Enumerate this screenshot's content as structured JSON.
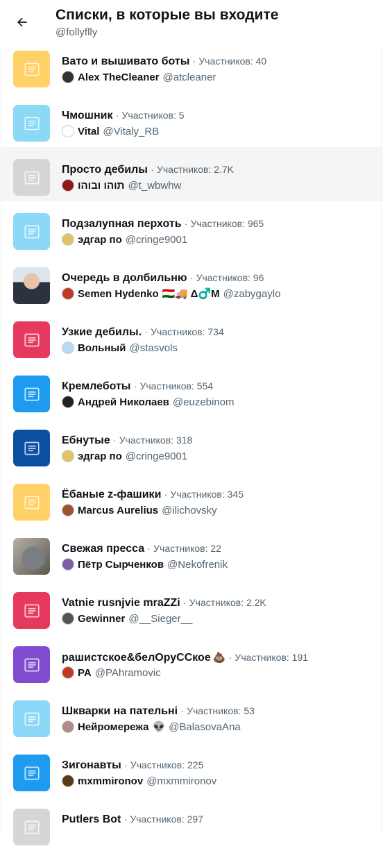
{
  "header": {
    "title": "Списки, в которые вы входите",
    "handle": "@follyflly"
  },
  "dot": "·",
  "lists": [
    {
      "name": "Вато и вышивато боты",
      "count": "Участников: 40",
      "owner": "Alex TheCleaner",
      "owner_handle": "@atcleaner",
      "thumb_color": "#ffd166",
      "avatar_color": "#333333"
    },
    {
      "name": "Чмошник",
      "count": "Участников: 5",
      "owner": "Vital",
      "owner_handle": "@Vitaly_RB",
      "thumb_color": "#8bd8f7",
      "avatar_color": "#ffffff"
    },
    {
      "name": "Просто дебилы",
      "count": "Участников: 2.7K",
      "owner": "תוהו ובוהו",
      "owner_handle": "@t_wbwhw",
      "thumb_color": "#d6d6d6",
      "avatar_color": "#8b1a1a"
    },
    {
      "name": "Подзалупная перхоть",
      "count": "Участников: 965",
      "owner": "эдгар по",
      "owner_handle": "@cringe9001",
      "thumb_color": "#8bd8f7",
      "avatar_color": "#e0c36a"
    },
    {
      "name": "Очередь в долбильню",
      "count": "Участников: 96",
      "owner": "Semen Hydenko",
      "owner_emoji": "🇹🇯🚚 Δ♂️M",
      "owner_handle": "@zabygaylo",
      "thumb_color": "#c9ced6",
      "avatar_color": "#c0392b",
      "thumb_photo": "person"
    },
    {
      "name": "Узкие дебилы.",
      "count": "Участников: 734",
      "owner": "Вольный",
      "owner_handle": "@stasvols",
      "thumb_color": "#e5395e",
      "avatar_color": "#b9d9f0"
    },
    {
      "name": "Кремлеботы",
      "count": "Участников: 554",
      "owner": "Андрей Николаев",
      "owner_handle": "@euzebinom",
      "thumb_color": "#1d9bf0",
      "avatar_color": "#222222"
    },
    {
      "name": "Ебнутые",
      "count": "Участников: 318",
      "owner": "эдгар по",
      "owner_handle": "@cringe9001",
      "thumb_color": "#0b4fa3",
      "avatar_color": "#e0c36a"
    },
    {
      "name": "Ёбаные z-фашики",
      "count": "Участников: 345",
      "owner": "Marcus Aurelius",
      "owner_handle": "@ilichovsky",
      "thumb_color": "#ffd166",
      "avatar_color": "#a0522d"
    },
    {
      "name": "Свежая пресса",
      "count": "Участников: 22",
      "owner": "Пётр Сырченков",
      "owner_handle": "@Nekofrenik",
      "thumb_color": "#8b8f95",
      "avatar_color": "#7b5ea7",
      "thumb_photo": "cat"
    },
    {
      "name": "Vatnie rusnjvie mraZZi",
      "count": "Участников: 2.2K",
      "owner": "Gewinner",
      "owner_handle": "@__Sieger__",
      "thumb_color": "#e5395e",
      "avatar_color": "#555555"
    },
    {
      "name": "рашистское&белОруССкое",
      "name_emoji": "💩",
      "count": "Участников: 191",
      "owner": "PA",
      "owner_handle": "@PAhramovic",
      "thumb_color": "#7f4ccf",
      "avatar_color": "#c0392b"
    },
    {
      "name": "Шкварки на пательні",
      "count": "Участников: 53",
      "owner": "Нейромережа",
      "owner_emoji": "👽",
      "owner_handle": "@BalasovaAna",
      "thumb_color": "#8bd8f7",
      "avatar_color": "#b08b8b"
    },
    {
      "name": "Зигонавты",
      "count": "Участников: 225",
      "owner": "mxmmironov",
      "owner_handle": "@mxmmironov",
      "thumb_color": "#1d9bf0",
      "avatar_color": "#5a3a1a"
    },
    {
      "name": "Putlers Bot",
      "count": "Участников: 297",
      "owner": "",
      "owner_handle": "",
      "thumb_color": "#d6d6d6",
      "avatar_color": "#a0522d"
    }
  ]
}
